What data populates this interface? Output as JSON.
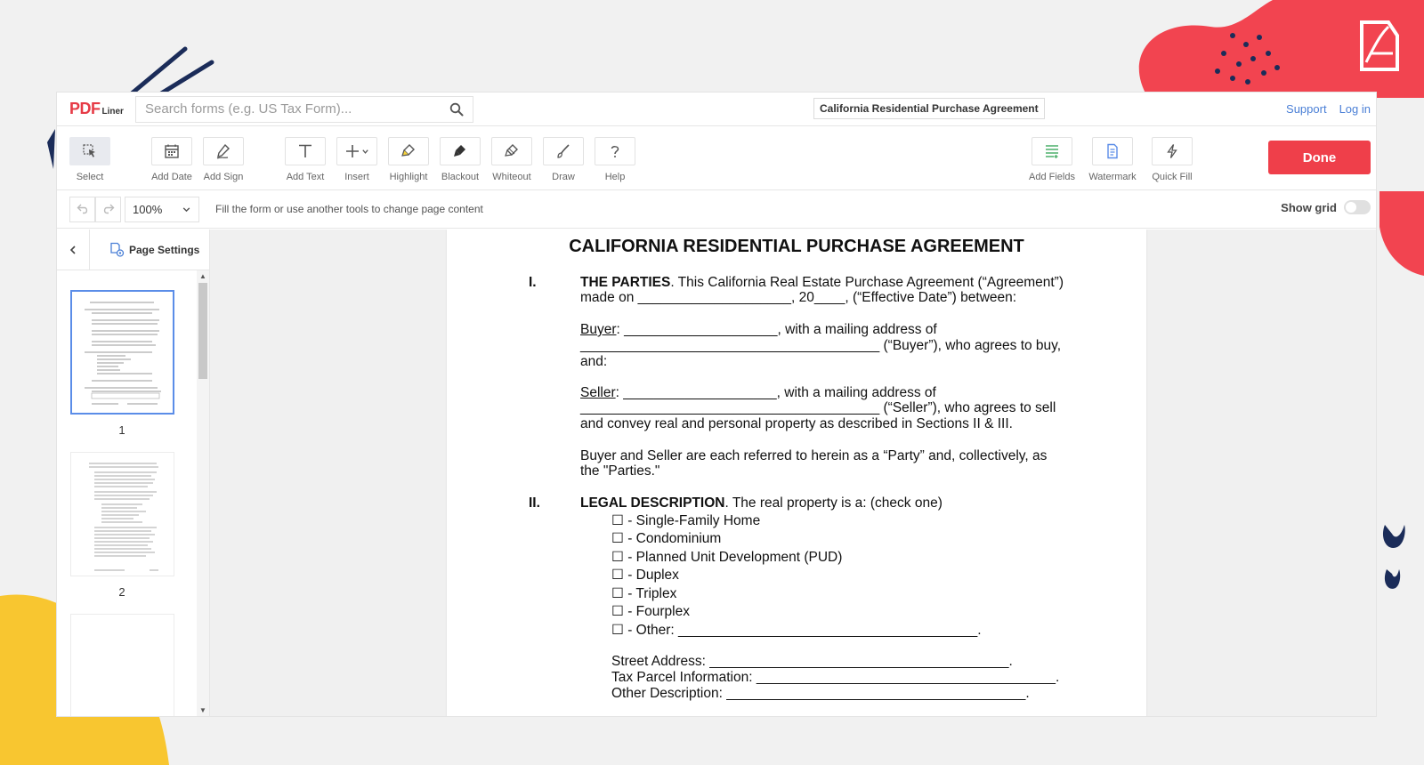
{
  "app": {
    "logo_main": "PDF",
    "logo_sub": "Liner",
    "search_placeholder": "Search forms (e.g. US Tax Form)...",
    "document_title": "California Residential Purchase Agreement",
    "links": {
      "support": "Support",
      "login": "Log in"
    }
  },
  "toolbar": {
    "tools": {
      "select": "Select",
      "add_date": "Add Date",
      "add_sign": "Add Sign",
      "add_text": "Add Text",
      "insert": "Insert",
      "highlight": "Highlight",
      "blackout": "Blackout",
      "whiteout": "Whiteout",
      "draw": "Draw",
      "help": "Help",
      "add_fields": "Add Fields",
      "watermark": "Watermark",
      "quick_fill": "Quick Fill"
    },
    "done_label": "Done"
  },
  "subbar": {
    "zoom": "100%",
    "hint": "Fill the form or use another tools to change page content",
    "show_grid_label": "Show grid"
  },
  "sidebar": {
    "page_settings_label": "Page Settings",
    "pages": [
      "1",
      "2"
    ]
  },
  "document": {
    "title": "CALIFORNIA RESIDENTIAL PURCHASE AGREEMENT",
    "s1_num": "I.",
    "s1_head": "THE PARTIES",
    "s1_l1": ". This California Real Estate Purchase Agreement (“Agreement”)",
    "s1_l2": "made on ____________________, 20____, (“Effective Date”) between:",
    "buyer_label": "Buyer",
    "buyer_l1": ": ____________________, with a mailing address of",
    "buyer_l2": "_______________________________________ (“Buyer”), who agrees to buy,",
    "buyer_l3": "and:",
    "seller_label": "Seller",
    "seller_l1": ": ____________________, with a mailing address of",
    "seller_l2": "_______________________________________ (“Seller”), who agrees to sell",
    "seller_l3": "and convey real and personal property as described in Sections II & III.",
    "parties_l1": "Buyer and Seller are each referred to herein as a “Party” and, collectively, as",
    "parties_l2": "the \"Parties.\"",
    "s2_num": "II.",
    "s2_head": "LEGAL DESCRIPTION",
    "s2_l1": ". The real property is a: (check one)",
    "options": [
      "☐ - Single-Family Home",
      "☐ - Condominium",
      "☐ - Planned Unit Development (PUD)",
      "☐ - Duplex",
      "☐ - Triplex",
      "☐ - Fourplex",
      "☐ - Other: _______________________________________."
    ],
    "street": "Street Address: _______________________________________.",
    "parcel": "Tax Parcel Information: _______________________________________.",
    "other_desc": "Other Description: _______________________________________."
  },
  "colors": {
    "accent_red": "#ef3f4a",
    "link_blue": "#4a7fd6",
    "thumb_selected": "#5b8de8",
    "deco_yellow": "#f8c630",
    "deco_navy": "#1b2c59"
  }
}
